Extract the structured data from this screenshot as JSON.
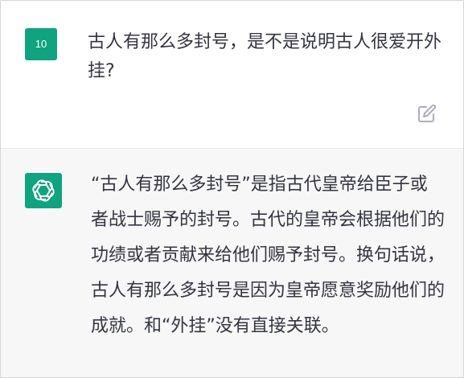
{
  "user_message": {
    "avatar_label": "10",
    "avatar_color": "#10a37f",
    "text": "古人有那么多封号，是不是说明古人很爱开外挂?",
    "edit_icon": "edit-icon"
  },
  "assistant_message": {
    "avatar_icon": "openai-logo-icon",
    "avatar_color": "#10a37f",
    "text": "“古人有那么多封号”是指古代皇帝给臣子或者战士赐予的封号。古代的皇帝会根据他们的功绩或者贡献来给他们赐予封号。换句话说，古人有那么多封号是因为皇帝愿意奖励他们的成就。和“外挂”没有直接关联。"
  }
}
